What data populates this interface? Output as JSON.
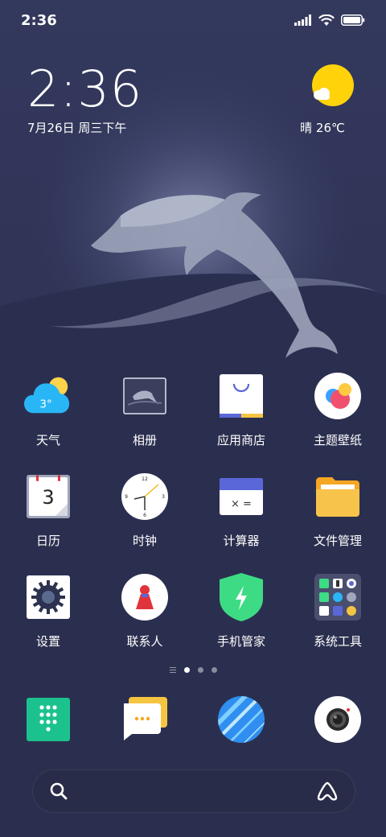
{
  "status_bar": {
    "time": "2:36",
    "icons": [
      "signal-icon",
      "wifi-icon",
      "battery-icon"
    ]
  },
  "clock_widget": {
    "time": "2:36",
    "date": "7月26日 周三下午"
  },
  "weather_widget": {
    "icon": "sunny-cloud-icon",
    "text": "晴 26℃"
  },
  "apps": [
    {
      "label": "天气",
      "icon": "weather-icon",
      "badge_text": "3°"
    },
    {
      "label": "相册",
      "icon": "gallery-icon"
    },
    {
      "label": "应用商店",
      "icon": "app-store-icon"
    },
    {
      "label": "主题壁纸",
      "icon": "themes-icon"
    },
    {
      "label": "日历",
      "icon": "calendar-icon",
      "badge_text": "3"
    },
    {
      "label": "时钟",
      "icon": "clock-icon"
    },
    {
      "label": "计算器",
      "icon": "calculator-icon",
      "badge_text": "×  ="
    },
    {
      "label": "文件管理",
      "icon": "file-manager-icon"
    },
    {
      "label": "设置",
      "icon": "settings-icon"
    },
    {
      "label": "联系人",
      "icon": "contacts-icon"
    },
    {
      "label": "手机管家",
      "icon": "security-icon"
    },
    {
      "label": "系统工具",
      "icon": "tools-folder-icon"
    }
  ],
  "page_indicator": {
    "pages": 3,
    "current": 1
  },
  "dock": [
    {
      "icon": "phone-dialer-icon"
    },
    {
      "icon": "messages-icon"
    },
    {
      "icon": "browser-icon"
    },
    {
      "icon": "camera-icon"
    }
  ],
  "search_bar": {
    "left_icon": "search-icon",
    "right_icon": "assistant-icon"
  },
  "colors": {
    "background_top": "#3a3f66",
    "background_bottom": "#2a2e4c",
    "accent_yellow": "#ffd20a",
    "weather_blue": "#29b6f6",
    "security_green": "#3ddc84"
  }
}
